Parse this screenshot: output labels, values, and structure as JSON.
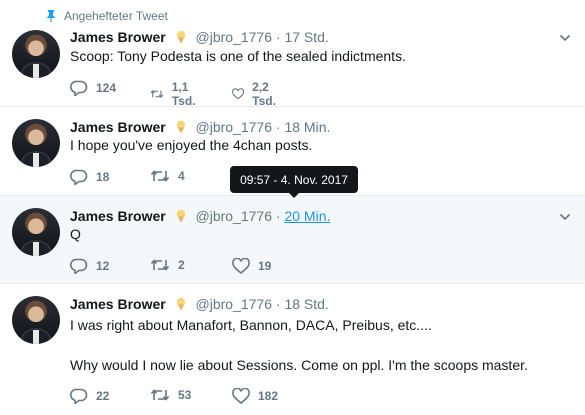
{
  "pinned_label": "Angehefteter Tweet",
  "tooltip": "09:57 - 4. Nov. 2017",
  "tweets": [
    {
      "name": "James Brower",
      "handle": "@jbro_1776",
      "time": "17 Std.",
      "text": "Scoop: Tony Podesta is one of the sealed indictments.",
      "replies": "124",
      "retweets": "1,1 Tsd.",
      "likes": "2,2 Tsd."
    },
    {
      "name": "James Brower",
      "handle": "@jbro_1776",
      "time": "18 Min.",
      "text": "I hope you've enjoyed the 4chan posts.",
      "replies": "18",
      "retweets": "4",
      "likes": ""
    },
    {
      "name": "James Brower",
      "handle": "@jbro_1776",
      "time": "20 Min.",
      "text": "Q",
      "replies": "12",
      "retweets": "2",
      "likes": "19"
    },
    {
      "name": "James Brower",
      "handle": "@jbro_1776",
      "time": "18 Std.",
      "text": "I was right about Manafort, Bannon, DACA, Preibus, etc....\n\nWhy would I now lie about Sessions. Come on ppl. I'm the scoops master.",
      "replies": "22",
      "retweets": "53",
      "likes": "182"
    }
  ],
  "colors": {
    "accent": "#1da1f2",
    "link": "#1b95e0",
    "muted": "#657786",
    "hover_bg": "#f5f8fa"
  }
}
